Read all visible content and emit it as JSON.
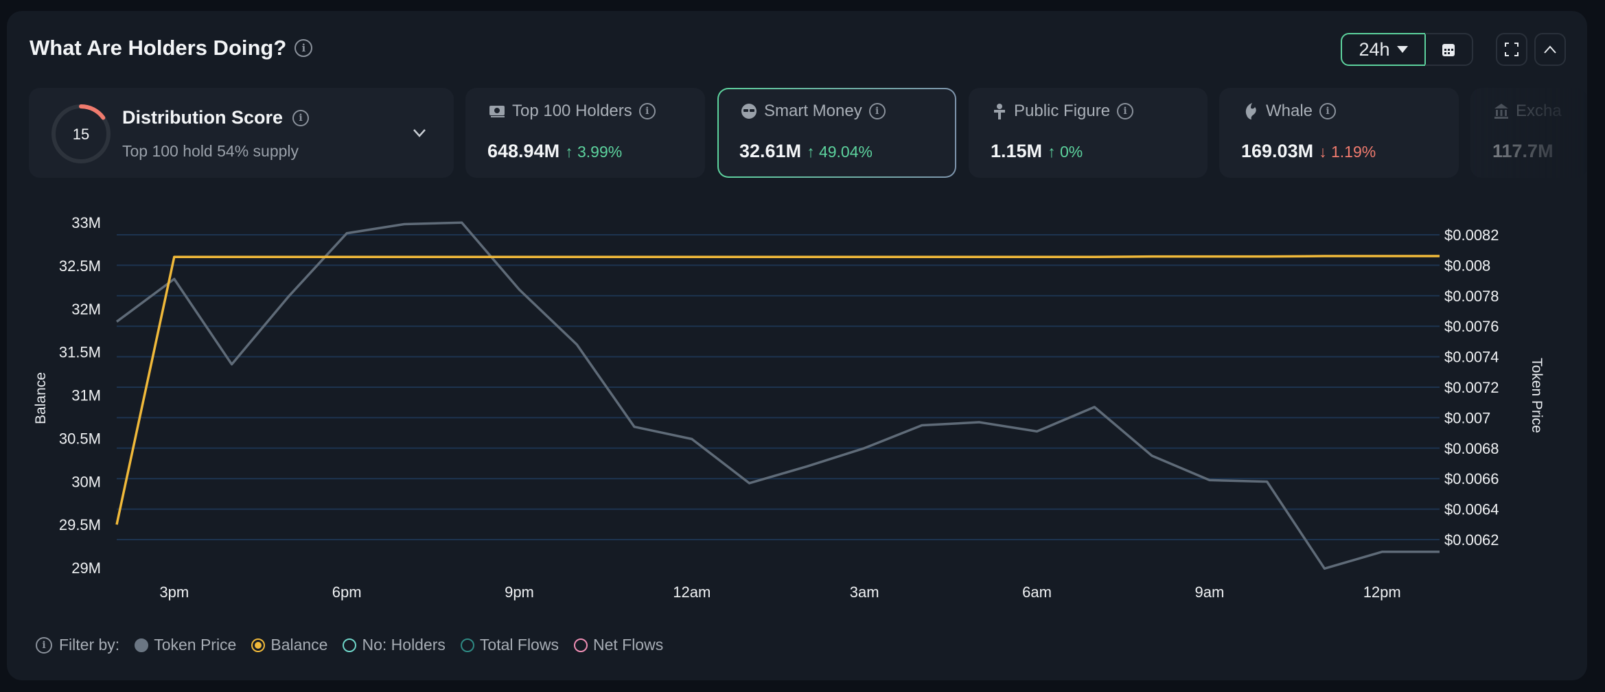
{
  "header": {
    "title": "What Are Holders Doing?",
    "range": "24h"
  },
  "distribution": {
    "score": "15",
    "score_fraction": 0.15,
    "title": "Distribution Score",
    "subtitle": "Top 100 hold 54% supply"
  },
  "stats": [
    {
      "label": "Top 100 Holders",
      "icon": "cash-icon",
      "value": "648.94M",
      "change": "3.99%",
      "direction": "up"
    },
    {
      "label": "Smart Money",
      "icon": "sunglasses-icon",
      "value": "32.61M",
      "change": "49.04%",
      "direction": "up",
      "selected": true
    },
    {
      "label": "Public Figure",
      "icon": "podium-icon",
      "value": "1.15M",
      "change": "0%",
      "direction": "up"
    },
    {
      "label": "Whale",
      "icon": "whale-icon",
      "value": "169.03M",
      "change": "1.19%",
      "direction": "down"
    },
    {
      "label": "Excha",
      "icon": "bank-icon",
      "value": "117.7M"
    }
  ],
  "colors": {
    "up": "#5dd39e",
    "down": "#f07b6e",
    "token_price": "#5f6b78",
    "balance": "#f0b93a",
    "holders": "#6fd6c9",
    "total_flows": "#2f8a84",
    "net_flows": "#f08fb5"
  },
  "legend": {
    "prefix": "Filter by:",
    "items": [
      {
        "label": "Token Price",
        "state": "filled"
      },
      {
        "label": "Balance",
        "state": "selected"
      },
      {
        "label": "No: Holders",
        "state": "off"
      },
      {
        "label": "Total Flows",
        "state": "off"
      },
      {
        "label": "Net Flows",
        "state": "off"
      }
    ]
  },
  "chart_data": {
    "type": "line",
    "x": [
      "2pm",
      "3pm",
      "4pm",
      "5pm",
      "6pm",
      "7pm",
      "8pm",
      "9pm",
      "10pm",
      "11pm",
      "12am",
      "1am",
      "2am",
      "3am",
      "4am",
      "5am",
      "6am",
      "7am",
      "8am",
      "9am",
      "10am",
      "11am",
      "12pm",
      "1pm"
    ],
    "xticks": [
      "3pm",
      "6pm",
      "9pm",
      "12am",
      "3am",
      "6am",
      "9am",
      "12pm"
    ],
    "ylabel_left": "Balance",
    "ylabel_right": "Token Price",
    "yticks_left": [
      "33M",
      "32.5M",
      "32M",
      "31.5M",
      "31M",
      "30.5M",
      "30M",
      "29.5M",
      "29M"
    ],
    "yticks_right": [
      "$0.0082",
      "$0.008",
      "$0.0078",
      "$0.0076",
      "$0.0074",
      "$0.0072",
      "$0.007",
      "$0.0068",
      "$0.0066",
      "$0.0064",
      "$0.0062"
    ],
    "ylim_left": [
      29000000,
      33000000
    ],
    "ylim_right": [
      0.0062,
      0.0082
    ],
    "grid": true,
    "series": [
      {
        "name": "Token Price",
        "axis": "right",
        "values": [
          0.00763,
          0.00791,
          0.00735,
          0.0078,
          0.00821,
          0.00827,
          0.00828,
          0.00784,
          0.00748,
          0.00694,
          0.00686,
          0.00657,
          0.00668,
          0.0068,
          0.00695,
          0.00697,
          0.00691,
          0.00707,
          0.00675,
          0.00659,
          0.00658,
          0.00601,
          0.00612,
          0.00612
        ]
      },
      {
        "name": "Balance",
        "axis": "left",
        "values": [
          29500000,
          32600000,
          32600000,
          32600000,
          32600000,
          32600000,
          32600000,
          32600000,
          32600000,
          32600000,
          32600000,
          32600000,
          32600000,
          32600000,
          32600000,
          32600000,
          32600000,
          32600000,
          32605000,
          32605000,
          32605000,
          32610000,
          32610000,
          32610000
        ]
      }
    ]
  }
}
